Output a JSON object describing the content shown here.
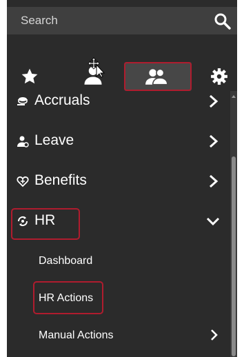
{
  "search": {
    "placeholder": "Search",
    "icon": "search-icon"
  },
  "tabs": [
    {
      "name": "favorites",
      "icon": "star-icon"
    },
    {
      "name": "my-info",
      "icon": "person-icon"
    },
    {
      "name": "team",
      "icon": "people-icon",
      "active": true
    },
    {
      "name": "settings",
      "icon": "gear-icon"
    }
  ],
  "menu": {
    "items": [
      {
        "label": "Accruals",
        "icon": "coins-icon"
      },
      {
        "label": "Leave",
        "icon": "person-away-icon"
      },
      {
        "label": "Benefits",
        "icon": "heart-icon"
      },
      {
        "label": "HR",
        "icon": "hr-cycle-icon",
        "expanded": true
      }
    ],
    "hr_subitems": [
      {
        "label": "Dashboard"
      },
      {
        "label": "HR Actions"
      },
      {
        "label": "Manual Actions"
      }
    ]
  },
  "colors": {
    "panel": "#2b2b2b",
    "search_bg": "#3f3f3f",
    "active_tab": "#474747",
    "highlight": "#b01c2e",
    "text": "#ffffff"
  }
}
